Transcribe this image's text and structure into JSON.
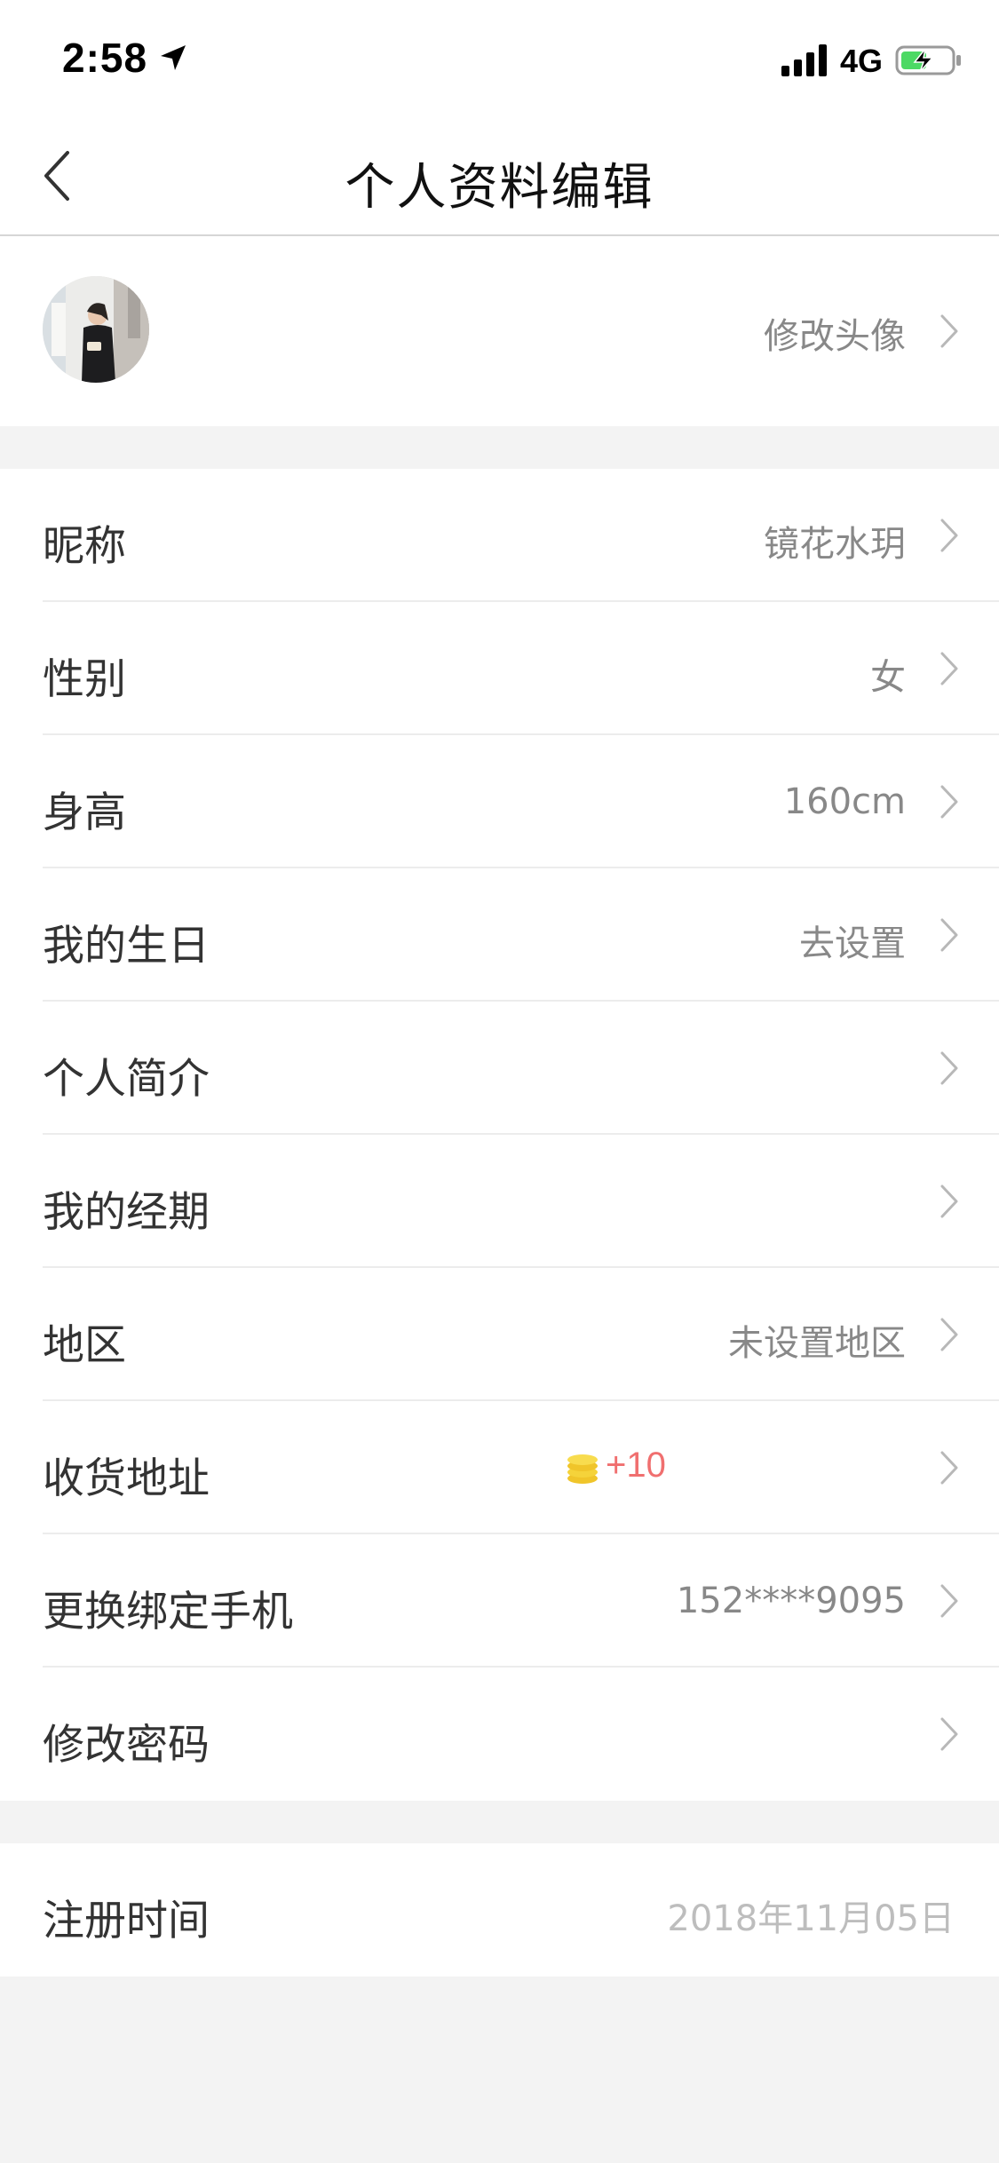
{
  "status_bar": {
    "time": "2:58",
    "network": "4G",
    "location_icon": "location-arrow-icon",
    "signal_icon": "cellular-signal-icon",
    "battery_icon": "battery-charging-icon"
  },
  "nav": {
    "title": "个人资料编辑",
    "back_icon": "chevron-left-icon"
  },
  "avatar_section": {
    "action_label": "修改头像"
  },
  "profile_rows": [
    {
      "label": "昵称",
      "value": "镜花水玥"
    },
    {
      "label": "性别",
      "value": "女"
    },
    {
      "label": "身高",
      "value": "160cm"
    },
    {
      "label": "我的生日",
      "value": "去设置"
    },
    {
      "label": "个人简介",
      "value": ""
    },
    {
      "label": "我的经期",
      "value": ""
    },
    {
      "label": "地区",
      "value": "未设置地区"
    },
    {
      "label": "收货地址",
      "value": "",
      "reward": "+10",
      "reward_icon": "coin-stack-icon"
    },
    {
      "label": "更换绑定手机",
      "value": "152****9095"
    },
    {
      "label": "修改密码",
      "value": ""
    }
  ],
  "register": {
    "label": "注册时间",
    "value": "2018年11月05日"
  },
  "colors": {
    "background": "#f3f3f3",
    "reward_text": "#f06f6f",
    "coin": "#f5d33a"
  }
}
